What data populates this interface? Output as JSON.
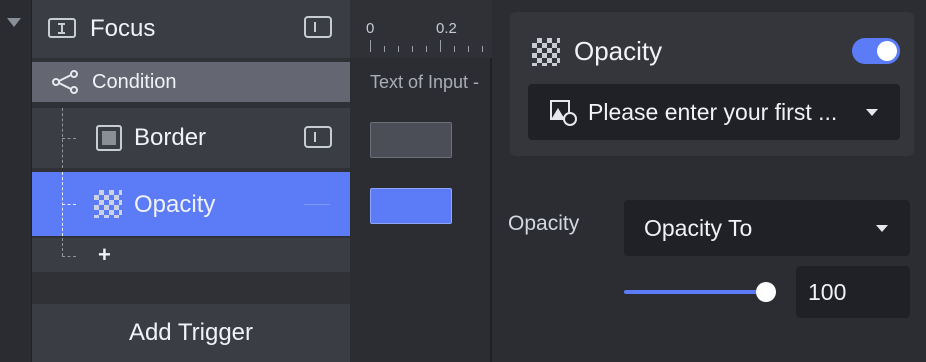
{
  "layers": {
    "focus": {
      "label": "Focus"
    },
    "condition": {
      "label": "Condition"
    },
    "border": {
      "label": "Border"
    },
    "opacity": {
      "label": "Opacity"
    },
    "add_symbol": "+",
    "add_trigger_label": "Add Trigger"
  },
  "timeline": {
    "ticks": [
      "0",
      "0.2"
    ],
    "track_label": "Text of Input -"
  },
  "inspector": {
    "title": "Opacity",
    "enabled": true,
    "target_select": {
      "value": "Please enter your first ..."
    },
    "property_label": "Opacity",
    "mode_select": {
      "value": "Opacity To"
    },
    "slider": {
      "value": 100,
      "max": 100
    },
    "value_box": "100"
  },
  "colors": {
    "accent": "#5b7cf6",
    "panel_bg": "#2b2d33",
    "row_bg": "#3a3d44",
    "condition_bg": "#646772",
    "field_bg": "#1f2126"
  },
  "icons": {
    "focus": "text-cursor-icon",
    "condition": "branch-icon",
    "border": "square-frame-icon",
    "opacity": "checkerboard-icon",
    "target": "image-shapes-icon"
  }
}
